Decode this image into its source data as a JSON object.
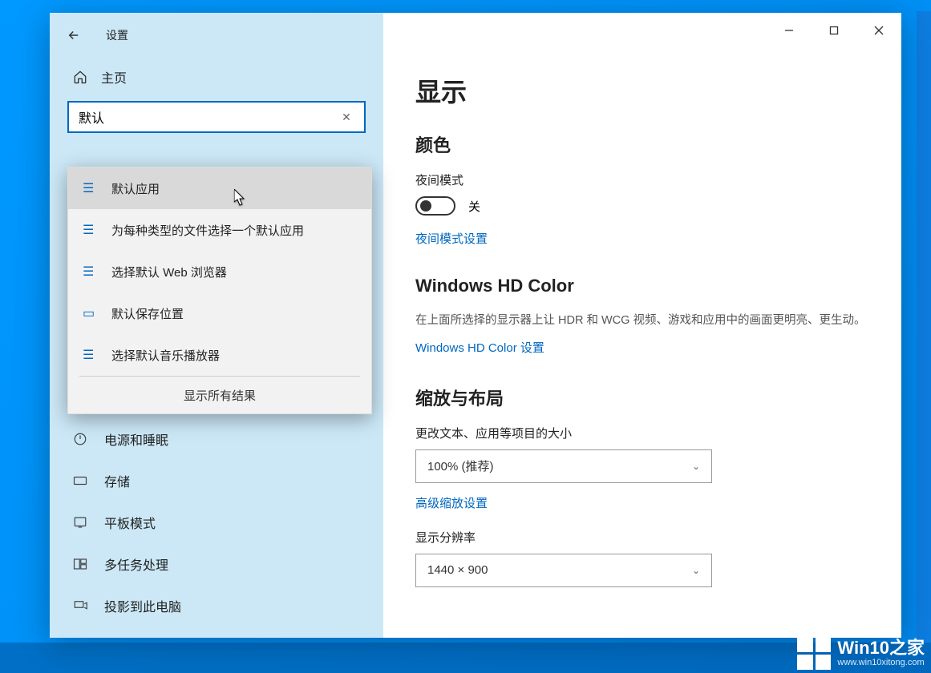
{
  "window": {
    "title": "设置",
    "home": "主页"
  },
  "search": {
    "value": "默认"
  },
  "suggestions": {
    "items": [
      {
        "label": "默认应用"
      },
      {
        "label": "为每种类型的文件选择一个默认应用"
      },
      {
        "label": "选择默认 Web 浏览器"
      },
      {
        "label": "默认保存位置"
      },
      {
        "label": "选择默认音乐播放器"
      }
    ],
    "show_all": "显示所有结果"
  },
  "sidebar": {
    "items": [
      {
        "label": "电源和睡眠"
      },
      {
        "label": "存储"
      },
      {
        "label": "平板模式"
      },
      {
        "label": "多任务处理"
      },
      {
        "label": "投影到此电脑"
      }
    ]
  },
  "main": {
    "heading": "显示",
    "color": {
      "title": "颜色",
      "night_mode_label": "夜间模式",
      "night_mode_state": "关",
      "night_mode_link": "夜间模式设置"
    },
    "hd": {
      "title": "Windows HD Color",
      "desc": "在上面所选择的显示器上让 HDR 和 WCG 视频、游戏和应用中的画面更明亮、更生动。",
      "link": "Windows HD Color 设置"
    },
    "scale": {
      "title": "缩放与布局",
      "text_size_label": "更改文本、应用等项目的大小",
      "text_size_value": "100% (推荐)",
      "advanced_link": "高级缩放设置",
      "resolution_label": "显示分辨率",
      "resolution_value": "1440 × 900"
    }
  },
  "watermark": {
    "title": "Win10之家",
    "url": "www.win10xitong.com"
  }
}
